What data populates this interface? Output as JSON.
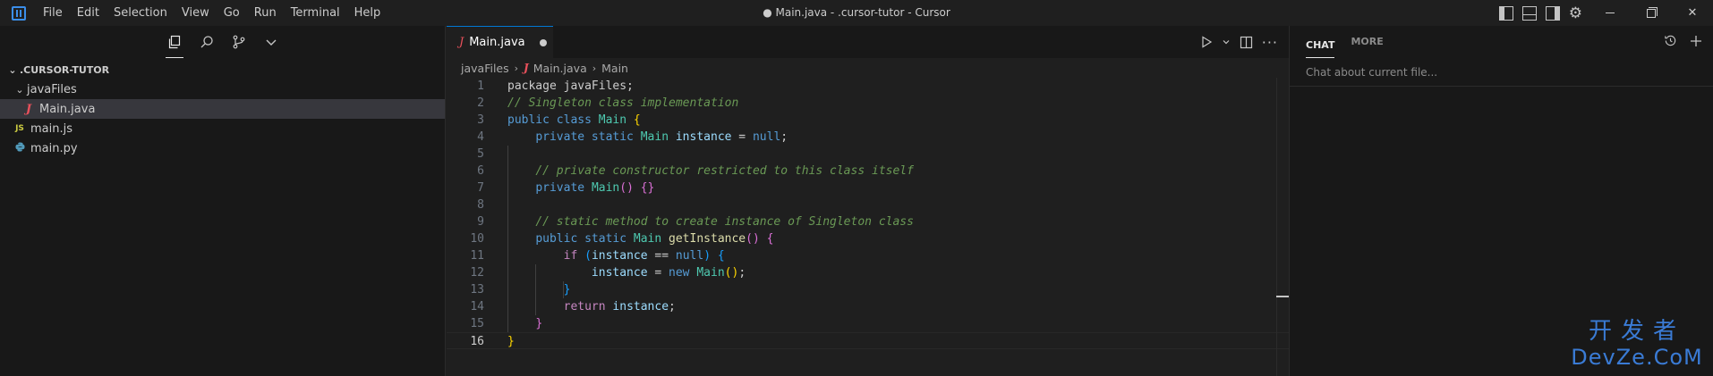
{
  "menubar": {
    "items": [
      "File",
      "Edit",
      "Selection",
      "View",
      "Go",
      "Run",
      "Terminal",
      "Help"
    ]
  },
  "window": {
    "title": "● Main.java - .cursor-tutor - Cursor"
  },
  "sidebar": {
    "root": ".CURSOR-TUTOR",
    "tree": [
      {
        "label": "javaFiles",
        "type": "folder",
        "expanded": true
      },
      {
        "label": "Main.java",
        "type": "java",
        "selected": true
      },
      {
        "label": "main.js",
        "type": "js"
      },
      {
        "label": "main.py",
        "type": "py"
      }
    ]
  },
  "editor": {
    "tab": {
      "label": "Main.java",
      "modified": true
    },
    "breadcrumb": [
      "javaFiles",
      "Main.java",
      "Main"
    ],
    "current_line": 16
  },
  "chat": {
    "tabs": [
      "CHAT",
      "MORE"
    ],
    "placeholder": "Chat about current file..."
  },
  "icons": {
    "java": "J",
    "js": "JS"
  },
  "watermark": {
    "top": "开发者",
    "bottom": "DevZe.CoM"
  },
  "colors": {
    "accent": "#0078d4",
    "java_icon": "#e8505b",
    "js_icon": "#cbcb41",
    "py_icon": "#519aba",
    "watermark": "#3a7bd5"
  }
}
